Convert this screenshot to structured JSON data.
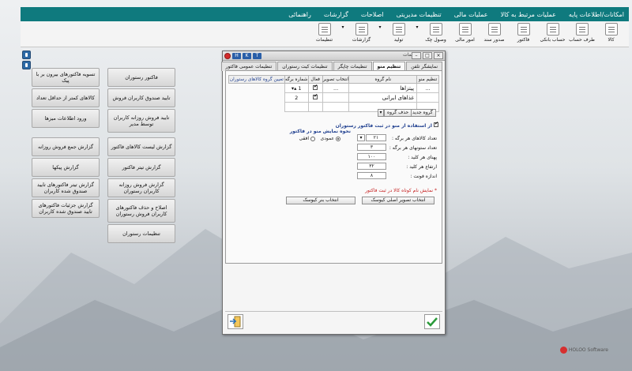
{
  "menu": [
    "امکانات/اطلاعات پایه",
    "عملیات مرتبط به کالا",
    "عملیات مالی",
    "تنظیمات مدیریتی",
    "اصلاحات",
    "گزارشات",
    "راهنمائی"
  ],
  "toolbar": [
    "کالا",
    "طرف حساب",
    "حساب بانکی",
    "فاکتور",
    "صدور سند",
    "امور مالی",
    "وصول چک",
    "تولید",
    "گزارشات",
    "تنظیمات"
  ],
  "left_buttons": {
    "col_right": [
      "فاکتور رستوران",
      "تایید صندوق کاربران فروش",
      "تایید فروش روزانه کاربران توسط مدیر",
      "گزارش لیست کالاهای فاکتور",
      "گزارش تیتر فاکتور",
      "گزارش فروش روزانه کاربران رستوران",
      "اصلاح و حذف فاکتورهای کاربران فروش رستوران",
      "تنظیمات رستوران"
    ],
    "col_left": [
      "تسویه فاکتورهای بیرون بر با پیک",
      "کالاهای کمتر از حداقل تعداد",
      "ورود اطلاعات میزها",
      "گزارش جمع فروش روزانه",
      "گزارش پیکها",
      "گزارش تیتر فاکتورهای تایید صندوق شده کاربران",
      "گزارش جزئیات فاکتورهای تایید صندوق شده کاربران"
    ]
  },
  "dialog": {
    "title": "تنظیمات",
    "title_tabs": [
      "H",
      "K",
      "T"
    ],
    "tabs": [
      "نمایشگر تلفن",
      "تنظیم منو",
      "تنظیمات چاپگر",
      "تنظیمات کیت رستوران",
      "تنظیمات عمومی فاکتور"
    ],
    "grid": {
      "headers": [
        "تنظیم منو",
        "نام گروه",
        "انتخاب تصویر",
        "فعال",
        "شماره برگه"
      ],
      "rows": [
        {
          "name": "پیتزاها",
          "action": "...",
          "image": "...",
          "page": "1"
        },
        {
          "name": "غذاهای ایرانی",
          "action": "",
          "image": "",
          "page": "2"
        }
      ],
      "group_label": "تعیین گروه کالاهای رستوران"
    },
    "new_group": "گروه جدید",
    "delete_group": "حذف گروه",
    "use_menu_check": "از استفاده از منو در ثبت فاکتور رستوران",
    "display_heading": "نحوه نمایش منو در فاکتور",
    "display_vertical": "عمودی",
    "display_horizontal": "افقی",
    "fields": [
      {
        "label": "تعداد کالاهای هر برگه :",
        "value": "۲۱"
      },
      {
        "label": "تعداد ستونهای هر برگه :",
        "value": "۳"
      },
      {
        "label": "پهنای هر کلید :",
        "value": "۱۰۰"
      },
      {
        "label": "ارتفاع هر کلید :",
        "value": "۳۲"
      },
      {
        "label": "اندازه فونت :",
        "value": "۸"
      }
    ],
    "show_name_note": "* نمایش نام کوتاه کالا در ثبت فاکتور",
    "choose_icon": "انتخاب تصویر اصلی کیوسک",
    "choose_banner": "انتخاب بنر کیوسک"
  },
  "brand": "HOLOO Software"
}
